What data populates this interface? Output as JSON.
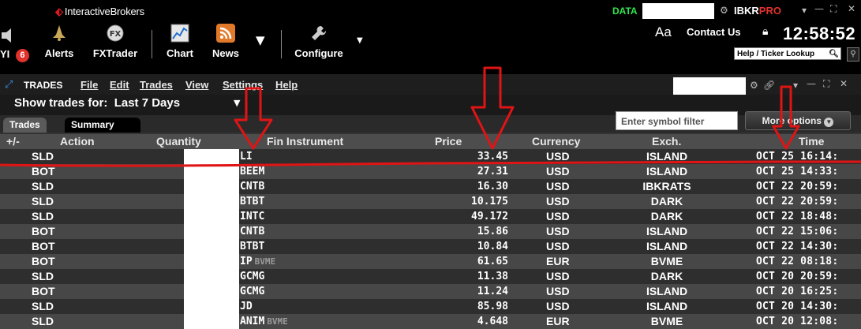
{
  "topbar": {
    "brand": "InteractiveBrokers",
    "data_label": "DATA",
    "ibkr": "IBKR",
    "pro": "PRO",
    "clock": "12:58:52",
    "contact_us": "Contact Us",
    "font_label": "Aa",
    "help_lookup": "Help / Ticker Lookup",
    "tools": [
      {
        "label": "YI",
        "badge": "6"
      },
      {
        "label": "Alerts"
      },
      {
        "label": "FXTrader"
      },
      {
        "label": "Chart"
      },
      {
        "label": "News"
      },
      {
        "label": "Configure"
      }
    ]
  },
  "window": {
    "title": "TRADES",
    "menu": [
      "File",
      "Edit",
      "Trades",
      "View",
      "Settings",
      "Help"
    ],
    "show_for_label": "Show trades for:",
    "show_for_value": "Last 7 Days",
    "tabs": [
      "Trades",
      "Summary"
    ],
    "filter_placeholder": "Enter symbol filter",
    "more_options": "More options"
  },
  "table": {
    "columns": [
      "+/-",
      "Action",
      "Quantity",
      "Fin Instrument",
      "Price",
      "Currency",
      "Exch.",
      "Time"
    ],
    "rows": [
      {
        "action": "SLD",
        "instrument": "LI",
        "suffix": "",
        "price": "33.45",
        "currency": "USD",
        "exchange": "ISLAND",
        "time": "OCT 25 16:14:"
      },
      {
        "action": "BOT",
        "instrument": "BEEM",
        "suffix": "",
        "price": "27.31",
        "currency": "USD",
        "exchange": "ISLAND",
        "time": "OCT 25 14:33:"
      },
      {
        "action": "SLD",
        "instrument": "CNTB",
        "suffix": "",
        "price": "16.30",
        "currency": "USD",
        "exchange": "IBKRATS",
        "time": "OCT 22 20:59:"
      },
      {
        "action": "SLD",
        "instrument": "BTBT",
        "suffix": "",
        "price": "10.175",
        "currency": "USD",
        "exchange": "DARK",
        "time": "OCT 22 20:59:"
      },
      {
        "action": "SLD",
        "instrument": "INTC",
        "suffix": "",
        "price": "49.172",
        "currency": "USD",
        "exchange": "DARK",
        "time": "OCT 22 18:48:"
      },
      {
        "action": "BOT",
        "instrument": "CNTB",
        "suffix": "",
        "price": "15.86",
        "currency": "USD",
        "exchange": "ISLAND",
        "time": "OCT 22 15:06:"
      },
      {
        "action": "BOT",
        "instrument": "BTBT",
        "suffix": "",
        "price": "10.84",
        "currency": "USD",
        "exchange": "ISLAND",
        "time": "OCT 22 14:30:"
      },
      {
        "action": "BOT",
        "instrument": "IP",
        "suffix": "BVME",
        "price": "61.65",
        "currency": "EUR",
        "exchange": "BVME",
        "time": "OCT 22 08:18:"
      },
      {
        "action": "SLD",
        "instrument": "GCMG",
        "suffix": "",
        "price": "11.38",
        "currency": "USD",
        "exchange": "DARK",
        "time": "OCT 20 20:59:"
      },
      {
        "action": "BOT",
        "instrument": "GCMG",
        "suffix": "",
        "price": "11.24",
        "currency": "USD",
        "exchange": "ISLAND",
        "time": "OCT 20 16:25:"
      },
      {
        "action": "SLD",
        "instrument": "JD",
        "suffix": "",
        "price": "85.98",
        "currency": "USD",
        "exchange": "ISLAND",
        "time": "OCT 20 14:30:"
      },
      {
        "action": "SLD",
        "instrument": "ANIM",
        "suffix": "BVME",
        "price": "4.648",
        "currency": "EUR",
        "exchange": "BVME",
        "time": "OCT 20 12:08:"
      }
    ]
  },
  "colors": {
    "annotation_red": "#e01414",
    "data_green": "#2ee84d",
    "brand_red": "#d81b21"
  }
}
